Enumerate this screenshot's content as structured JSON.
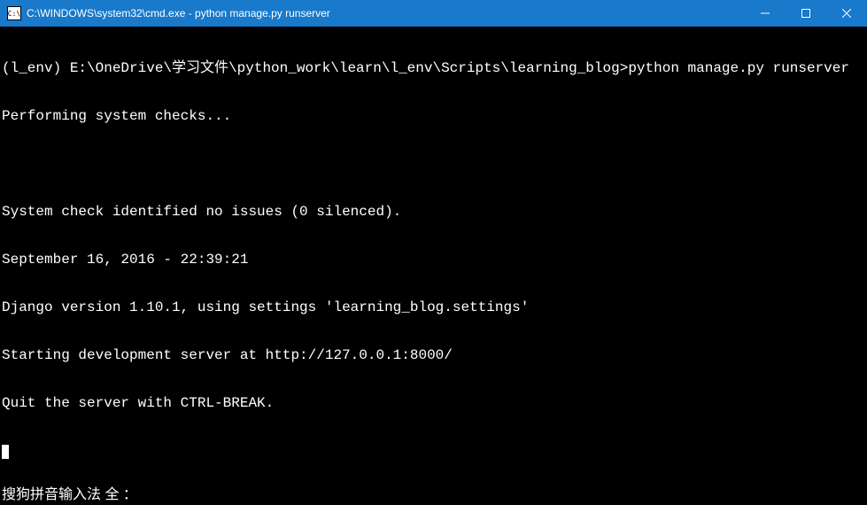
{
  "titlebar": {
    "icon_label": "C:\\",
    "title": "C:\\WINDOWS\\system32\\cmd.exe - python  manage.py runserver"
  },
  "terminal": {
    "prompt_prefix": "(l_env) E:\\OneDrive\\学习文件\\python_work\\learn\\l_env\\Scripts\\learning_blog>",
    "command": "python manage.py runserver",
    "lines": [
      "Performing system checks...",
      "",
      "System check identified no issues (0 silenced).",
      "September 16, 2016 - 22:39:21",
      "Django version 1.10.1, using settings 'learning_blog.settings'",
      "Starting development server at http://127.0.0.1:8000/",
      "Quit the server with CTRL-BREAK."
    ]
  },
  "ime": {
    "text": "搜狗拼音输入法 全 ："
  }
}
